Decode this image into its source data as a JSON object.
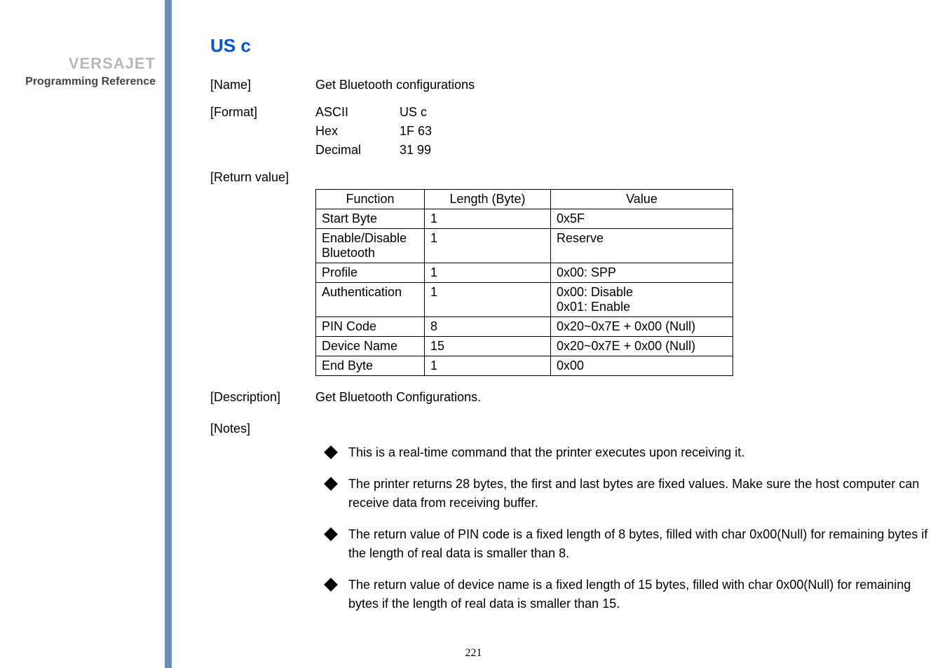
{
  "sidebar": {
    "brand": "VERSAJET",
    "subtitle": "Programming Reference"
  },
  "title": "US c",
  "name": {
    "label": "[Name]",
    "value": "Get Bluetooth configurations"
  },
  "format": {
    "label": "[Format]",
    "rows": [
      {
        "k": "ASCII",
        "v": "US c"
      },
      {
        "k": "Hex",
        "v": "1F 63"
      },
      {
        "k": "Decimal",
        "v": "31 99"
      }
    ]
  },
  "return_value": {
    "label": "[Return value]",
    "headers": {
      "function": "Function",
      "length": "Length (Byte)",
      "value": "Value"
    },
    "rows": [
      {
        "function": "Start Byte",
        "length": "1",
        "value": "0x5F"
      },
      {
        "function": "Enable/Disable Bluetooth",
        "length": "1",
        "value": "Reserve"
      },
      {
        "function": "Profile",
        "length": "1",
        "value": "0x00: SPP"
      },
      {
        "function": "Authentication",
        "length": "1",
        "value": "0x00: Disable\n0x01: Enable"
      },
      {
        "function": "PIN Code",
        "length": "8",
        "value": "0x20~0x7E + 0x00 (Null)"
      },
      {
        "function": "Device Name",
        "length": "15",
        "value": "0x20~0x7E + 0x00 (Null)"
      },
      {
        "function": "End Byte",
        "length": "1",
        "value": "0x00"
      }
    ]
  },
  "description": {
    "label": "[Description]",
    "value": "Get Bluetooth Configurations."
  },
  "notes": {
    "label": "[Notes]",
    "items": [
      "This is a real-time command that the printer executes upon receiving it.",
      "The printer returns 28 bytes, the first and last bytes are fixed values. Make sure the host computer can receive data from receiving buffer.",
      "The return value of PIN code is a fixed length of 8 bytes, filled with char 0x00(Null) for remaining bytes if the length of real data is smaller than 8.",
      "The return value of device name is a fixed length of 15 bytes, filled with char 0x00(Null) for remaining bytes if the length of real data is smaller than 15."
    ]
  },
  "page_number": "221"
}
